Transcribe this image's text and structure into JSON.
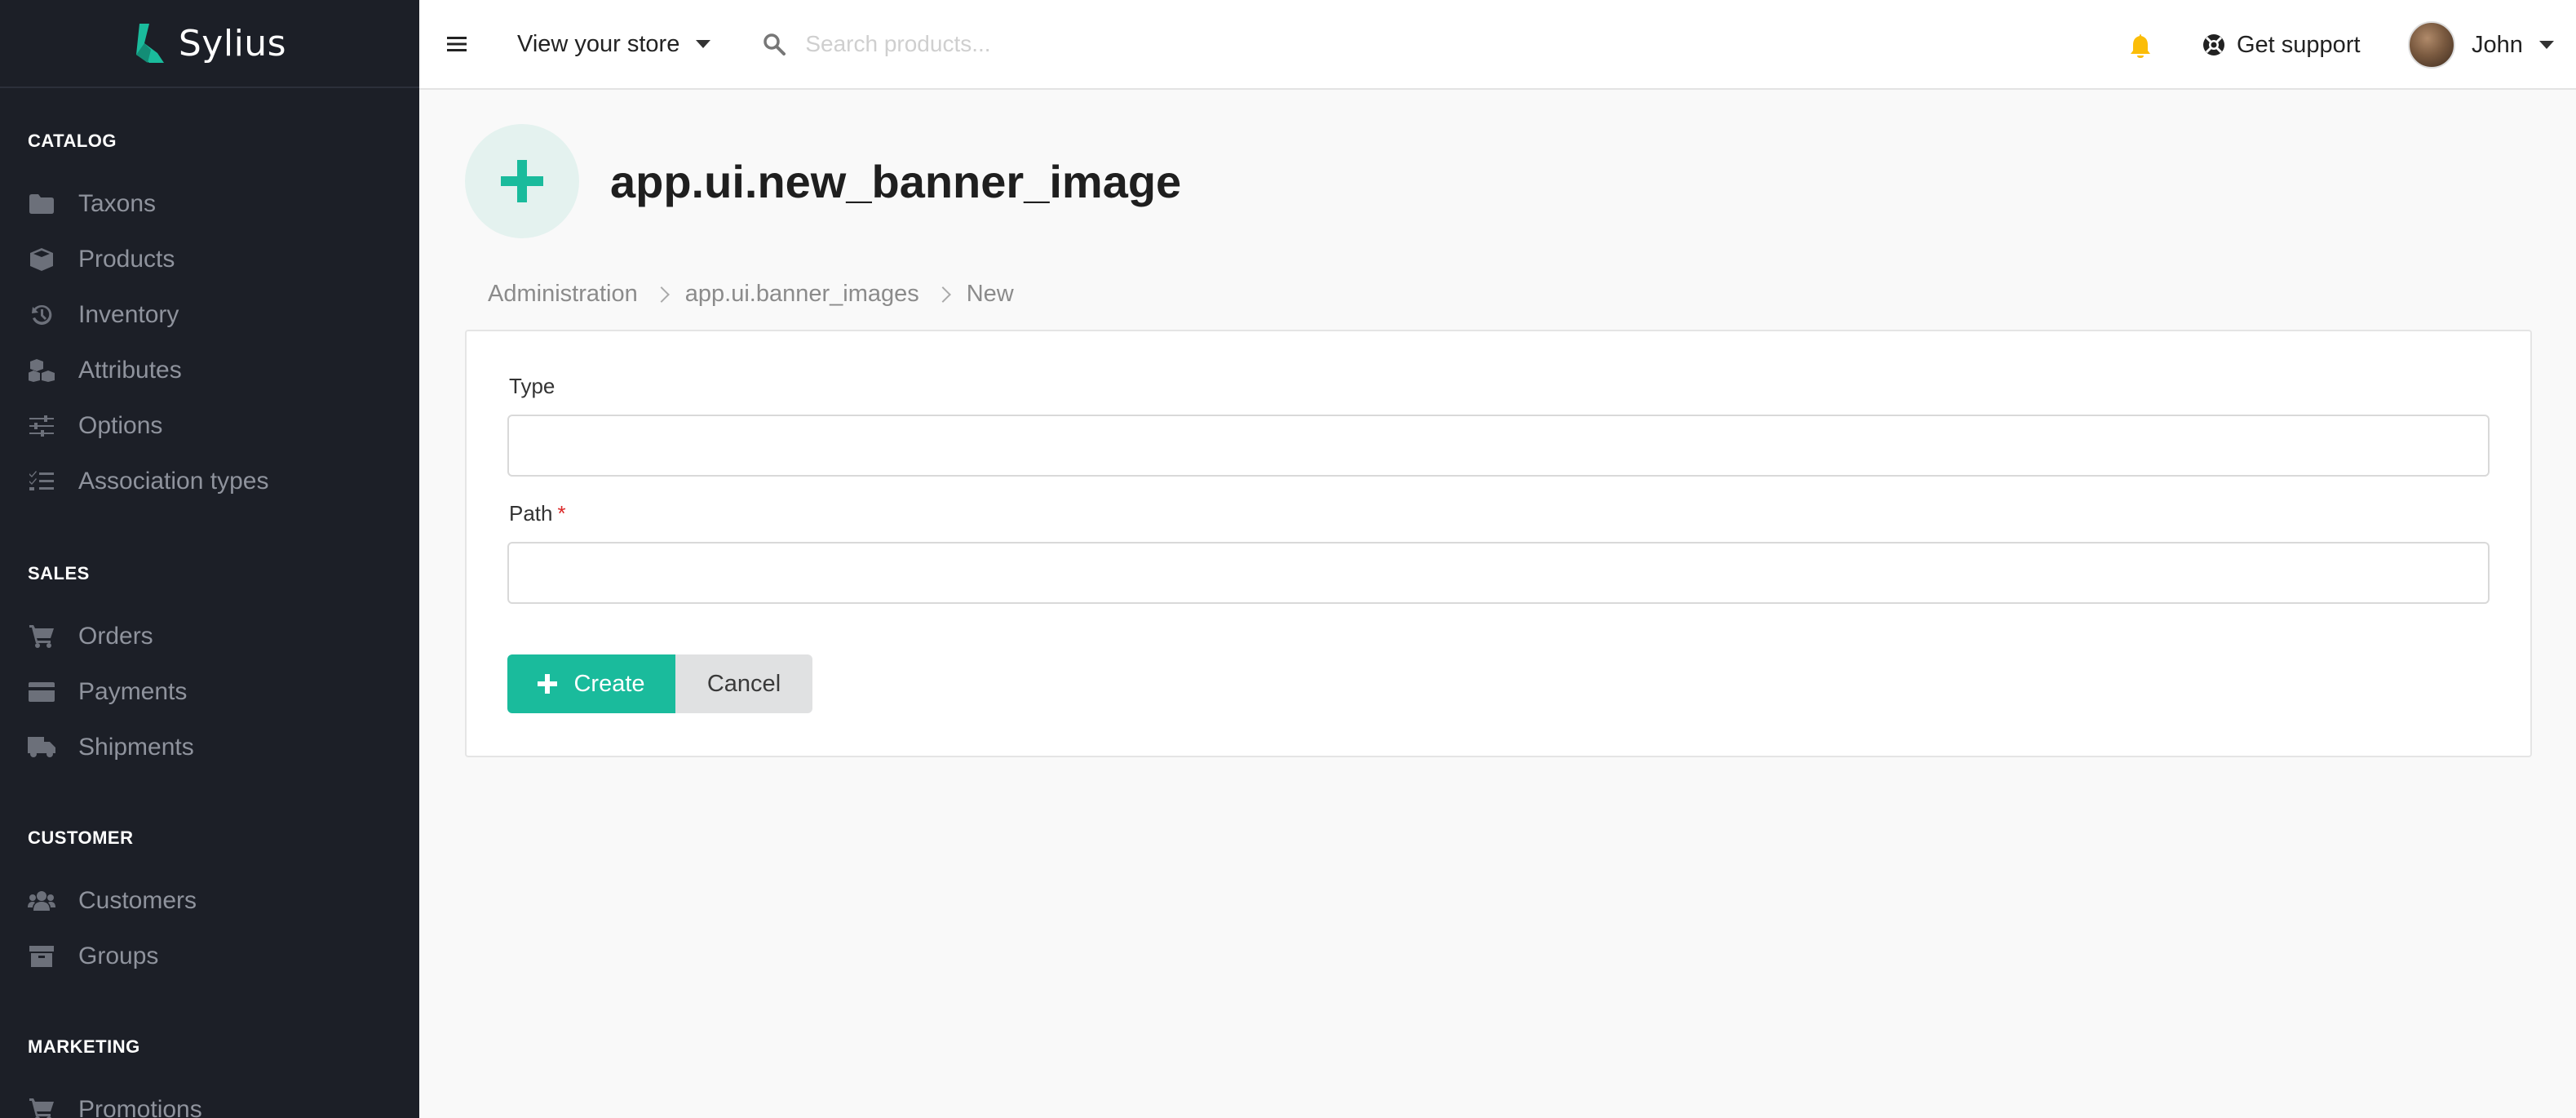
{
  "sidebar": {
    "brand": "Sylius",
    "sections": [
      {
        "title": "CATALOG",
        "items": [
          {
            "label": "Taxons",
            "icon": "folder-icon"
          },
          {
            "label": "Products",
            "icon": "cube-icon"
          },
          {
            "label": "Inventory",
            "icon": "history-icon"
          },
          {
            "label": "Attributes",
            "icon": "cubes-icon"
          },
          {
            "label": "Options",
            "icon": "sliders-icon"
          },
          {
            "label": "Association types",
            "icon": "tasks-icon"
          }
        ]
      },
      {
        "title": "SALES",
        "items": [
          {
            "label": "Orders",
            "icon": "cart-icon"
          },
          {
            "label": "Payments",
            "icon": "credit-card-icon"
          },
          {
            "label": "Shipments",
            "icon": "truck-icon"
          }
        ]
      },
      {
        "title": "CUSTOMER",
        "items": [
          {
            "label": "Customers",
            "icon": "users-icon"
          },
          {
            "label": "Groups",
            "icon": "archive-icon"
          }
        ]
      },
      {
        "title": "MARKETING",
        "items": [
          {
            "label": "Promotions",
            "icon": "cart-plus-icon"
          }
        ]
      }
    ]
  },
  "topbar": {
    "store_link": "View your store",
    "search_placeholder": "Search products...",
    "support": "Get support",
    "user": "John"
  },
  "page": {
    "title": "app.ui.new_banner_image",
    "breadcrumb": [
      "Administration",
      "app.ui.banner_images",
      "New"
    ]
  },
  "form": {
    "type_label": "Type",
    "type_value": "",
    "path_label": "Path",
    "path_required": "*",
    "path_value": "",
    "create_label": "Create",
    "cancel_label": "Cancel"
  },
  "colors": {
    "accent": "#1abb9c",
    "sidebar_bg": "#1c1f27",
    "bell": "#fbbd08",
    "required": "#db2828"
  }
}
